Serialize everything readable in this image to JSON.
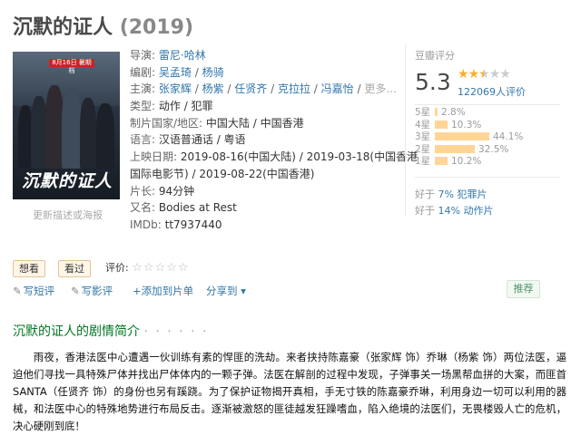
{
  "title": {
    "name": "沉默的证人",
    "year": "(2019)"
  },
  "poster": {
    "badge": "8月16日 暑期档",
    "text": "沉默的证人",
    "update_link": "更新描述或海报"
  },
  "info": {
    "director_label": "导演:",
    "director": "雷尼·哈林",
    "writer_label": "编剧:",
    "writers": [
      "吴孟琦",
      "杨骑"
    ],
    "cast_label": "主演:",
    "cast": [
      "张家辉",
      "杨紫",
      "任贤齐",
      "克拉拉",
      "冯嘉怡"
    ],
    "cast_more": "更多...",
    "genre_label": "类型:",
    "genre": "动作 / 犯罪",
    "country_label": "制片国家/地区:",
    "country": "中国大陆 / 中国香港",
    "language_label": "语言:",
    "language": "汉语普通话 / 粤语",
    "release_label": "上映日期:",
    "release_line1": "2019-08-16(中国大陆) / 2019-03-18(中国香港",
    "release_line2": "国际电影节) / 2019-08-22(中国香港)",
    "runtime_label": "片长:",
    "runtime": "94分钟",
    "aka_label": "又名:",
    "aka": "Bodies at Rest",
    "imdb_label": "IMDb:",
    "imdb": "tt7937440"
  },
  "rating": {
    "label": "豆瓣评分",
    "score": "5.3",
    "stars_filled": 2.5,
    "votes": "122069人评价",
    "distribution": [
      {
        "label": "5星",
        "pct": "2.8%",
        "value": 2.8
      },
      {
        "label": "4星",
        "pct": "10.3%",
        "value": 10.3
      },
      {
        "label": "3星",
        "pct": "44.1%",
        "value": 44.1
      },
      {
        "label": "2星",
        "pct": "32.5%",
        "value": 32.5
      },
      {
        "label": "1星",
        "pct": "10.2%",
        "value": 10.2
      }
    ],
    "better_than": [
      {
        "prefix": "好于",
        "link": "7% 犯罪片"
      },
      {
        "prefix": "好于",
        "link": "14% 动作片"
      }
    ]
  },
  "actions": {
    "want": "想看",
    "seen": "看过",
    "rate_label": "评价:",
    "write_review": "写短评",
    "write_long_review": "写影评",
    "add_to_list": "+添加到片单",
    "share": "分享到 ▾",
    "recommend": "推荐"
  },
  "synopsis": {
    "heading": "沉默的证人的剧情简介",
    "dots": "· · · · · ·",
    "body": "雨夜，香港法医中心遭遇一伙训练有素的悍匪的洗劫。来者挟持陈嘉豪（张家辉 饰）乔琳（杨紫 饰）两位法医，逼迫他们寻找一具特殊尸体并找出尸体体内的一颗子弹。法医在解剖的过程中发现，子弹事关一场黑帮血拼的大案，而匪首SANTA（任贤齐 饰）的身份也另有蹊跷。为了保护证物揭开真相，手无寸铁的陈嘉豪乔琳，利用身边一切可以利用的器械，和法医中心的特殊地势进行布局反击。逐渐被激怒的匪徒越发狂躁嗜血，陷入绝境的法医们，无畏楼毁人亡的危机，决心硬刚到底！"
  },
  "colors": {
    "link": "#3377aa",
    "star": "#ffac2d",
    "bar": "#ffd596",
    "heading": "#007722"
  }
}
